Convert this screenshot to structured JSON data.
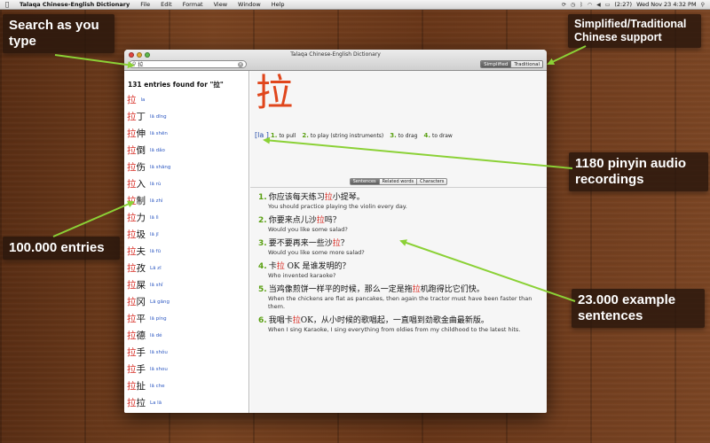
{
  "menubar": {
    "app_name": "Talaqa Chinese-English Dictionary",
    "items": [
      "File",
      "Edit",
      "Format",
      "View",
      "Window",
      "Help"
    ],
    "battery": "(2:27)",
    "clock": "Wed Nov 23  4:32 PM"
  },
  "window": {
    "title": "Talaqa Chinese-English Dictionary",
    "search": {
      "value": "拉"
    },
    "script_toggle": {
      "simplified": "Simplified",
      "traditional": "Traditional",
      "selected": "Simplified"
    }
  },
  "list": {
    "count_text": "131 entries found for \"拉\"",
    "entries": [
      {
        "pre": "",
        "hl": "拉",
        "post": "",
        "pinyin": "la"
      },
      {
        "pre": "",
        "hl": "拉",
        "post": "丁",
        "pinyin": "lā dīng"
      },
      {
        "pre": "",
        "hl": "拉",
        "post": "伸",
        "pinyin": "lā shēn"
      },
      {
        "pre": "",
        "hl": "拉",
        "post": "倒",
        "pinyin": "lā dǎo"
      },
      {
        "pre": "",
        "hl": "拉",
        "post": "伤",
        "pinyin": "lā shāng"
      },
      {
        "pre": "",
        "hl": "拉",
        "post": "入",
        "pinyin": "lā rù"
      },
      {
        "pre": "",
        "hl": "拉",
        "post": "制",
        "pinyin": "lā zhì"
      },
      {
        "pre": "",
        "hl": "拉",
        "post": "力",
        "pinyin": "lā lì"
      },
      {
        "pre": "",
        "hl": "拉",
        "post": "圾",
        "pinyin": "lā jī"
      },
      {
        "pre": "",
        "hl": "拉",
        "post": "夫",
        "pinyin": "lā fū"
      },
      {
        "pre": "",
        "hl": "拉",
        "post": "孜",
        "pinyin": "Lā zī"
      },
      {
        "pre": "",
        "hl": "拉",
        "post": "屎",
        "pinyin": "lā shǐ"
      },
      {
        "pre": "",
        "hl": "拉",
        "post": "冈",
        "pinyin": "Lā gāng"
      },
      {
        "pre": "",
        "hl": "拉",
        "post": "平",
        "pinyin": "lā píng"
      },
      {
        "pre": "",
        "hl": "拉",
        "post": "德",
        "pinyin": "lā dé"
      },
      {
        "pre": "",
        "hl": "拉",
        "post": "手",
        "pinyin": "lā shǒu"
      },
      {
        "pre": "",
        "hl": "拉",
        "post": "手",
        "pinyin": "lā shou"
      },
      {
        "pre": "",
        "hl": "拉",
        "post": "扯",
        "pinyin": "lā che"
      },
      {
        "pre": "",
        "hl": "拉",
        "post": "拉",
        "pinyin": "La lā"
      },
      {
        "pre": "",
        "hl": "拉",
        "post": "拉",
        "pinyin": "la la"
      },
      {
        "pre": "",
        "hl": "拉",
        "post": "拢",
        "pinyin": "lā lǒng"
      }
    ]
  },
  "definition": {
    "character": "拉",
    "pinyin": "[la ]",
    "meanings": [
      {
        "num": "1.",
        "text": "to pull"
      },
      {
        "num": "2.",
        "text": "to play (string instruments)"
      },
      {
        "num": "3.",
        "text": "to drag"
      },
      {
        "num": "4.",
        "text": "to draw"
      }
    ]
  },
  "tabs": {
    "sentences": "Sentences",
    "related": "Related words",
    "characters": "Characters",
    "selected": "Sentences"
  },
  "sentences": [
    {
      "num": "1.",
      "pre": "你应该每天练习",
      "hl": "拉",
      "post": "小提琴。",
      "en": "You should practice playing the violin every day."
    },
    {
      "num": "2.",
      "pre": "你要来点儿沙",
      "hl": "拉",
      "post": "吗？",
      "en": "Would you like some salad?"
    },
    {
      "num": "3.",
      "pre": "要不要再来一些沙",
      "hl": "拉",
      "post": "？",
      "en": "Would you like some more salad?"
    },
    {
      "num": "4.",
      "pre": "卡",
      "hl": "拉",
      "post": " OK 是谁发明的？",
      "en": "Who invented karaoke?"
    },
    {
      "num": "5.",
      "pre": "当鸡像煎饼一样平的时候，那么一定是拖",
      "hl": "拉",
      "post": "机跑得比它们快。",
      "en": "When the chickens are flat as pancakes, then again the tractor must have been faster than them."
    },
    {
      "num": "6.",
      "pre": "我唱卡",
      "hl": "拉",
      "post": "OK，从小时候的歌唱起，一直唱到劲歌金曲最新版。",
      "en": "When I sing Karaoke, I sing everything from oldies from my childhood to the latest hits."
    }
  ],
  "callouts": {
    "search": "Search as you type",
    "simplified": "Simplified/Traditional Chinese support",
    "entries": "100.000 entries",
    "audio": "1180 pinyin audio recordings",
    "sentences": "23.000 example sentences"
  },
  "colors": {
    "accent_red": "#d7271f",
    "big_char": "#e0461c",
    "number_green": "#5aa012",
    "pinyin_blue": "#2d58c2",
    "arrow_green": "#8bd136"
  }
}
